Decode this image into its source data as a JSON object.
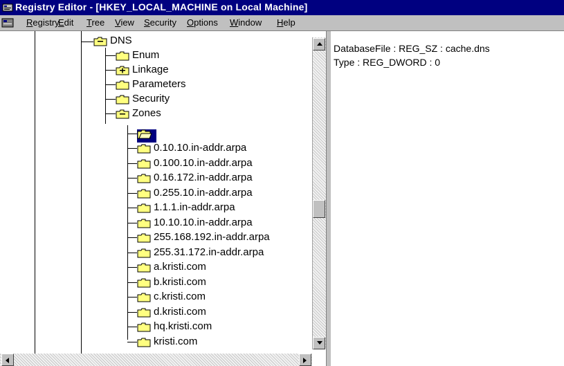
{
  "window": {
    "title": "Registry Editor - [HKEY_LOCAL_MACHINE on Local Machine]"
  },
  "menu": [
    {
      "label": "Registry",
      "ul": "R"
    },
    {
      "label": "Edit",
      "ul": "E"
    },
    {
      "label": "Tree",
      "ul": "T"
    },
    {
      "label": "View",
      "ul": "V"
    },
    {
      "label": "Security",
      "ul": "S"
    },
    {
      "label": "Options",
      "ul": "O"
    },
    {
      "label": "Window",
      "ul": "W"
    },
    {
      "label": "Help",
      "ul": "H"
    }
  ],
  "tree": {
    "parent": {
      "label": "DNS",
      "expanded": true
    },
    "children": [
      {
        "label": "Enum"
      },
      {
        "label": "Linkage",
        "expandable": true
      },
      {
        "label": "Parameters"
      },
      {
        "label": "Security"
      },
      {
        "label": "Zones",
        "expanded": true
      }
    ],
    "zones_selected": {
      "label": "",
      "selected": true
    },
    "zones": [
      "0.10.10.in-addr.arpa",
      "0.100.10.in-addr.arpa",
      "0.16.172.in-addr.arpa",
      "0.255.10.in-addr.arpa",
      "1.1.1.in-addr.arpa",
      "10.10.10.in-addr.arpa",
      "255.168.192.in-addr.arpa",
      "255.31.172.in-addr.arpa",
      "a.kristi.com",
      "b.kristi.com",
      "c.kristi.com",
      "d.kristi.com",
      "hq.kristi.com",
      "kristi.com"
    ]
  },
  "values": [
    "DatabaseFile : REG_SZ : cache.dns",
    "Type : REG_DWORD : 0"
  ],
  "colors": {
    "titlebar": "#000080",
    "selection": "#000080",
    "folder": "#ffff80"
  }
}
